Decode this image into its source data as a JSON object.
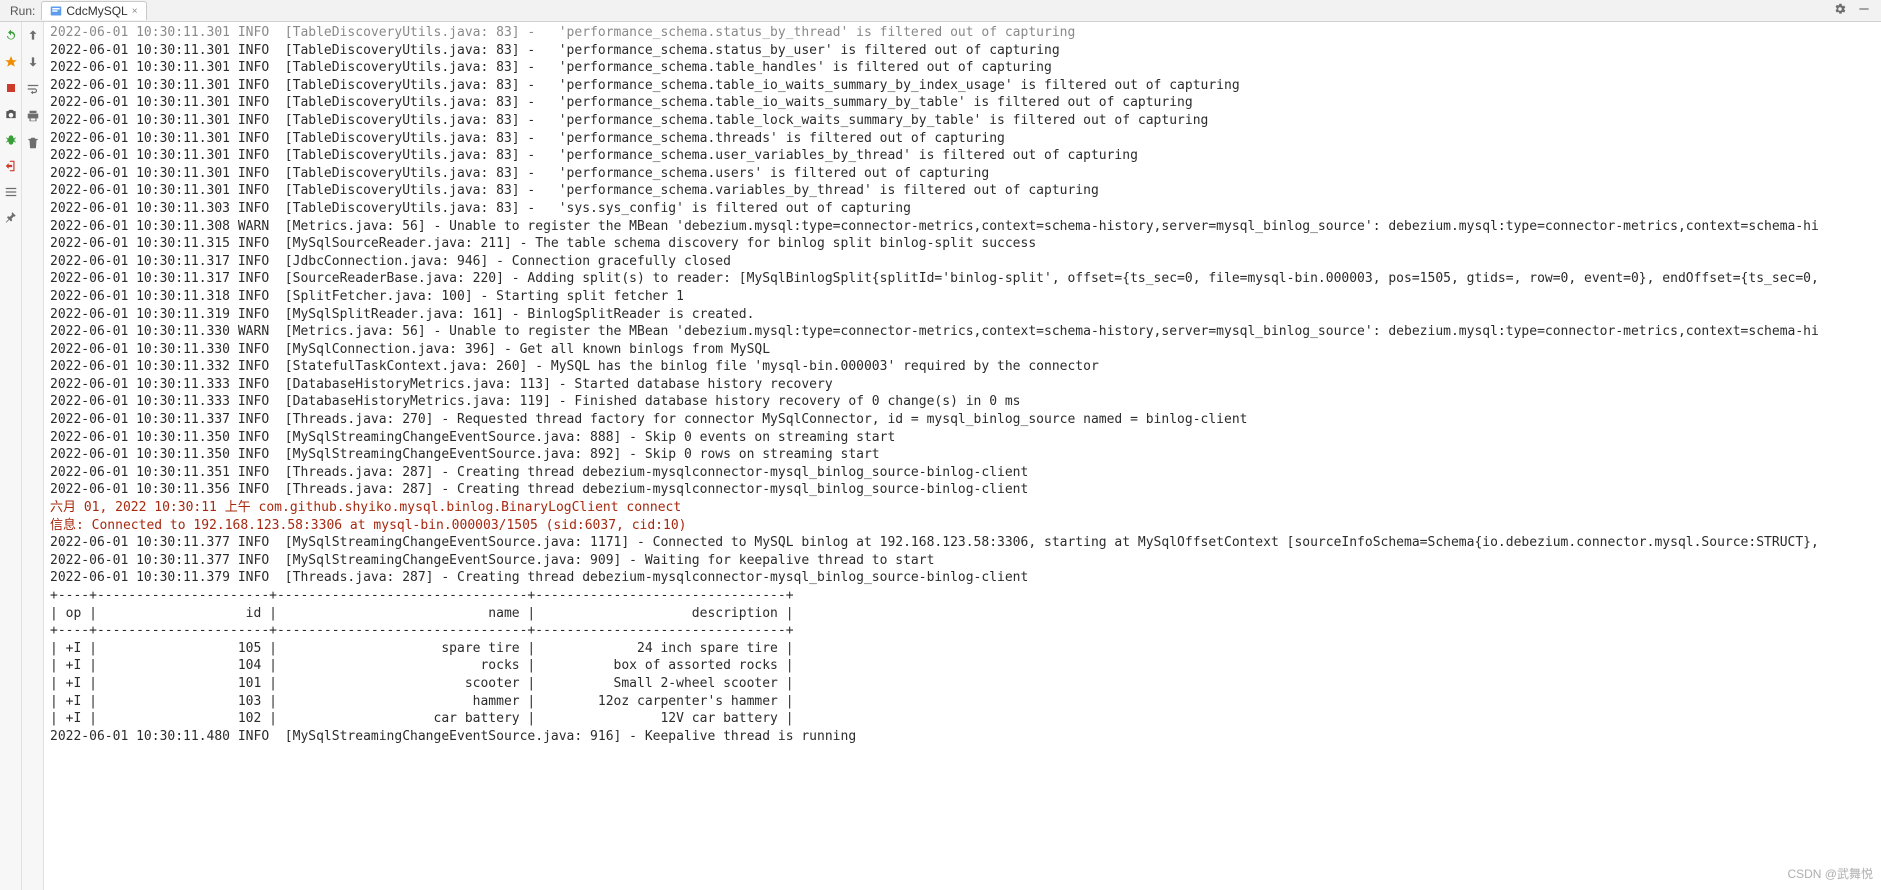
{
  "header": {
    "run_label": "Run:",
    "tab_name": "CdcMySQL"
  },
  "chart_data": {
    "type": "table",
    "columns": [
      "op",
      "id",
      "name",
      "description"
    ],
    "rows": [
      {
        "op": "+I",
        "id": 105,
        "name": "spare tire",
        "description": "24 inch spare tire"
      },
      {
        "op": "+I",
        "id": 104,
        "name": "rocks",
        "description": "box of assorted rocks"
      },
      {
        "op": "+I",
        "id": 101,
        "name": "scooter",
        "description": "Small 2-wheel scooter"
      },
      {
        "op": "+I",
        "id": 103,
        "name": "hammer",
        "description": "12oz carpenter's hammer"
      },
      {
        "op": "+I",
        "id": 102,
        "name": "car battery",
        "description": "12V car battery"
      }
    ]
  },
  "logs": [
    {
      "c": "2022-06-01 10:30:11.301 INFO  [TableDiscoveryUtils.java: 83] -   'performance_schema.status_by_thread' is filtered out of capturing",
      "red": false,
      "dim": true
    },
    {
      "c": "2022-06-01 10:30:11.301 INFO  [TableDiscoveryUtils.java: 83] -   'performance_schema.status_by_user' is filtered out of capturing",
      "red": false
    },
    {
      "c": "2022-06-01 10:30:11.301 INFO  [TableDiscoveryUtils.java: 83] -   'performance_schema.table_handles' is filtered out of capturing",
      "red": false
    },
    {
      "c": "2022-06-01 10:30:11.301 INFO  [TableDiscoveryUtils.java: 83] -   'performance_schema.table_io_waits_summary_by_index_usage' is filtered out of capturing",
      "red": false
    },
    {
      "c": "2022-06-01 10:30:11.301 INFO  [TableDiscoveryUtils.java: 83] -   'performance_schema.table_io_waits_summary_by_table' is filtered out of capturing",
      "red": false
    },
    {
      "c": "2022-06-01 10:30:11.301 INFO  [TableDiscoveryUtils.java: 83] -   'performance_schema.table_lock_waits_summary_by_table' is filtered out of capturing",
      "red": false
    },
    {
      "c": "2022-06-01 10:30:11.301 INFO  [TableDiscoveryUtils.java: 83] -   'performance_schema.threads' is filtered out of capturing",
      "red": false
    },
    {
      "c": "2022-06-01 10:30:11.301 INFO  [TableDiscoveryUtils.java: 83] -   'performance_schema.user_variables_by_thread' is filtered out of capturing",
      "red": false
    },
    {
      "c": "2022-06-01 10:30:11.301 INFO  [TableDiscoveryUtils.java: 83] -   'performance_schema.users' is filtered out of capturing",
      "red": false
    },
    {
      "c": "2022-06-01 10:30:11.301 INFO  [TableDiscoveryUtils.java: 83] -   'performance_schema.variables_by_thread' is filtered out of capturing",
      "red": false
    },
    {
      "c": "2022-06-01 10:30:11.303 INFO  [TableDiscoveryUtils.java: 83] -   'sys.sys_config' is filtered out of capturing",
      "red": false
    },
    {
      "c": "2022-06-01 10:30:11.308 WARN  [Metrics.java: 56] - Unable to register the MBean 'debezium.mysql:type=connector-metrics,context=schema-history,server=mysql_binlog_source': debezium.mysql:type=connector-metrics,context=schema-hi",
      "red": false
    },
    {
      "c": "2022-06-01 10:30:11.315 INFO  [MySqlSourceReader.java: 211] - The table schema discovery for binlog split binlog-split success",
      "red": false
    },
    {
      "c": "2022-06-01 10:30:11.317 INFO  [JdbcConnection.java: 946] - Connection gracefully closed",
      "red": false
    },
    {
      "c": "2022-06-01 10:30:11.317 INFO  [SourceReaderBase.java: 220] - Adding split(s) to reader: [MySqlBinlogSplit{splitId='binlog-split', offset={ts_sec=0, file=mysql-bin.000003, pos=1505, gtids=, row=0, event=0}, endOffset={ts_sec=0,",
      "red": false
    },
    {
      "c": "2022-06-01 10:30:11.318 INFO  [SplitFetcher.java: 100] - Starting split fetcher 1",
      "red": false
    },
    {
      "c": "2022-06-01 10:30:11.319 INFO  [MySqlSplitReader.java: 161] - BinlogSplitReader is created.",
      "red": false
    },
    {
      "c": "2022-06-01 10:30:11.330 WARN  [Metrics.java: 56] - Unable to register the MBean 'debezium.mysql:type=connector-metrics,context=schema-history,server=mysql_binlog_source': debezium.mysql:type=connector-metrics,context=schema-hi",
      "red": false
    },
    {
      "c": "2022-06-01 10:30:11.330 INFO  [MySqlConnection.java: 396] - Get all known binlogs from MySQL",
      "red": false
    },
    {
      "c": "2022-06-01 10:30:11.332 INFO  [StatefulTaskContext.java: 260] - MySQL has the binlog file 'mysql-bin.000003' required by the connector",
      "red": false
    },
    {
      "c": "2022-06-01 10:30:11.333 INFO  [DatabaseHistoryMetrics.java: 113] - Started database history recovery",
      "red": false
    },
    {
      "c": "2022-06-01 10:30:11.333 INFO  [DatabaseHistoryMetrics.java: 119] - Finished database history recovery of 0 change(s) in 0 ms",
      "red": false
    },
    {
      "c": "2022-06-01 10:30:11.337 INFO  [Threads.java: 270] - Requested thread factory for connector MySqlConnector, id = mysql_binlog_source named = binlog-client",
      "red": false
    },
    {
      "c": "2022-06-01 10:30:11.350 INFO  [MySqlStreamingChangeEventSource.java: 888] - Skip 0 events on streaming start",
      "red": false
    },
    {
      "c": "2022-06-01 10:30:11.350 INFO  [MySqlStreamingChangeEventSource.java: 892] - Skip 0 rows on streaming start",
      "red": false
    },
    {
      "c": "2022-06-01 10:30:11.351 INFO  [Threads.java: 287] - Creating thread debezium-mysqlconnector-mysql_binlog_source-binlog-client",
      "red": false
    },
    {
      "c": "2022-06-01 10:30:11.356 INFO  [Threads.java: 287] - Creating thread debezium-mysqlconnector-mysql_binlog_source-binlog-client",
      "red": false
    },
    {
      "c": "六月 01, 2022 10:30:11 上午 com.github.shyiko.mysql.binlog.BinaryLogClient connect",
      "red": true
    },
    {
      "c": "信息: Connected to 192.168.123.58:3306 at mysql-bin.000003/1505 (sid:6037, cid:10)",
      "red": true
    },
    {
      "c": "2022-06-01 10:30:11.377 INFO  [MySqlStreamingChangeEventSource.java: 1171] - Connected to MySQL binlog at 192.168.123.58:3306, starting at MySqlOffsetContext [sourceInfoSchema=Schema{io.debezium.connector.mysql.Source:STRUCT},",
      "red": false
    },
    {
      "c": "2022-06-01 10:30:11.377 INFO  [MySqlStreamingChangeEventSource.java: 909] - Waiting for keepalive thread to start",
      "red": false
    },
    {
      "c": "2022-06-01 10:30:11.379 INFO  [Threads.java: 287] - Creating thread debezium-mysqlconnector-mysql_binlog_source-binlog-client",
      "red": false
    },
    {
      "c": "+----+----------------------+--------------------------------+--------------------------------+",
      "red": false
    },
    {
      "c": "| op |                   id |                           name |                    description |",
      "red": false
    },
    {
      "c": "+----+----------------------+--------------------------------+--------------------------------+",
      "red": false
    },
    {
      "c": "| +I |                  105 |                     spare tire |             24 inch spare tire |",
      "red": false
    },
    {
      "c": "| +I |                  104 |                          rocks |          box of assorted rocks |",
      "red": false
    },
    {
      "c": "| +I |                  101 |                        scooter |          Small 2-wheel scooter |",
      "red": false
    },
    {
      "c": "| +I |                  103 |                         hammer |        12oz carpenter's hammer |",
      "red": false
    },
    {
      "c": "| +I |                  102 |                    car battery |                12V car battery |",
      "red": false
    },
    {
      "c": "2022-06-01 10:30:11.480 INFO  [MySqlStreamingChangeEventSource.java: 916] - Keepalive thread is running",
      "red": false
    }
  ],
  "watermark": "CSDN @武舞悦"
}
